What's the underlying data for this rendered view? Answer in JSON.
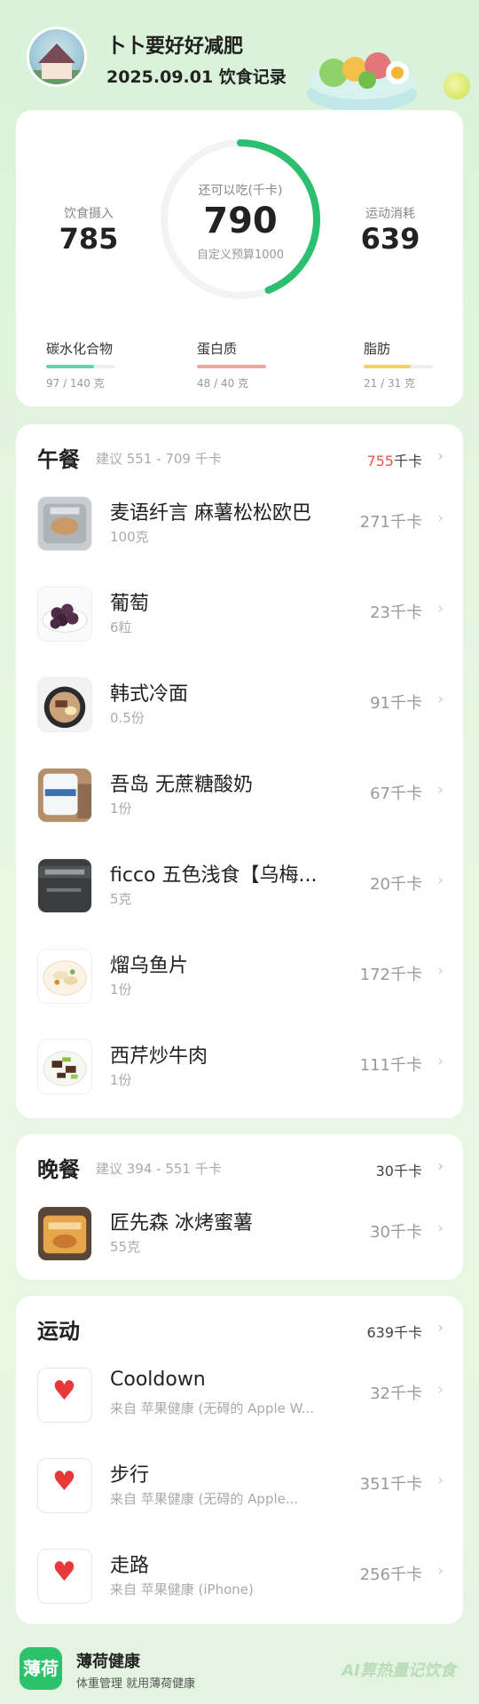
{
  "header": {
    "title": "卜卜要好好减肥",
    "subtitle": "2025.09.01 饮食记录"
  },
  "summary": {
    "intake_label": "饮食摄入",
    "intake_value": "785",
    "remaining_label": "还可以吃(千卡)",
    "remaining_value": "790",
    "budget_text": "自定义预算1000",
    "exercise_label": "运动消耗",
    "exercise_value": "639",
    "ring_progress": 0.44,
    "ring_color": "#2cbf6f",
    "macros": [
      {
        "name": "碳水化合物",
        "value": "97 / 140 克",
        "fraction": 0.69,
        "color": "#5fd6a8"
      },
      {
        "name": "蛋白质",
        "value": "48 / 40 克",
        "fraction": 1.0,
        "color": "#f3a3a3"
      },
      {
        "name": "脂肪",
        "value": "21 / 31 克",
        "fraction": 0.68,
        "color": "#f2d45a"
      }
    ]
  },
  "lunch": {
    "title": "午餐",
    "hint": "建议 551 - 709 千卡",
    "total_value": "755",
    "total_unit": "千卡",
    "items": [
      {
        "name": "麦语纤言 麻薯松松欧巴",
        "qty": "100克",
        "kcal": "271千卡",
        "thumb": "bread-thumb"
      },
      {
        "name": "葡萄",
        "qty": "6粒",
        "kcal": "23千卡",
        "thumb": "grape-thumb"
      },
      {
        "name": "韩式冷面",
        "qty": "0.5份",
        "kcal": "91千卡",
        "thumb": "noodle-thumb"
      },
      {
        "name": "吾岛 无蔗糖酸奶",
        "qty": "1份",
        "kcal": "67千卡",
        "thumb": "yogurt-thumb"
      },
      {
        "name": "ficco 五色浅食【乌梅...",
        "qty": "5克",
        "kcal": "20千卡",
        "thumb": "ficco-thumb"
      },
      {
        "name": "熘乌鱼片",
        "qty": "1份",
        "kcal": "172千卡",
        "thumb": "fish-thumb"
      },
      {
        "name": "西芹炒牛肉",
        "qty": "1份",
        "kcal": "111千卡",
        "thumb": "beef-thumb"
      }
    ]
  },
  "dinner": {
    "title": "晚餐",
    "hint": "建议 394 - 551 千卡",
    "total": "30千卡",
    "items": [
      {
        "name": "匠先森 冰烤蜜薯",
        "qty": "55克",
        "kcal": "30千卡",
        "thumb": "sweet-potato-thumb"
      }
    ]
  },
  "exercise": {
    "title": "运动",
    "total": "639千卡",
    "items": [
      {
        "name": "Cooldown",
        "source": "来自 苹果健康 (无碍的 Apple W...",
        "kcal": "32千卡"
      },
      {
        "name": "步行",
        "source": "来自 苹果健康 (无碍的 Apple...",
        "kcal": "351千卡"
      },
      {
        "name": "走路",
        "source": "来自 苹果健康 (iPhone)",
        "kcal": "256千卡"
      }
    ]
  },
  "footer": {
    "logo_text": "薄荷",
    "brand": "薄荷健康",
    "slogan": "体重管理 就用薄荷健康",
    "right_text": "AI算热量记饮食"
  }
}
